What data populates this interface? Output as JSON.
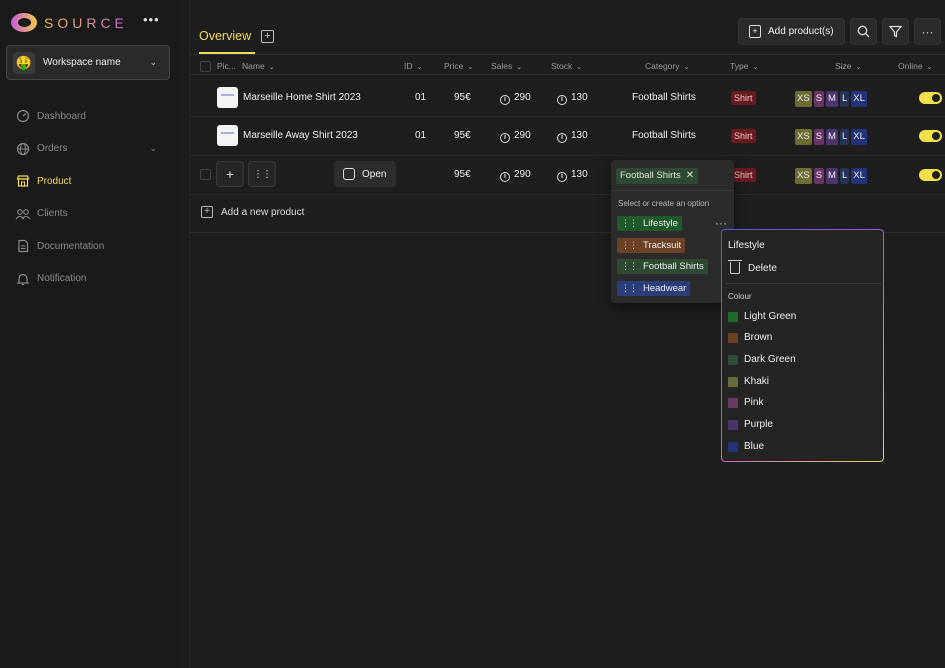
{
  "brand": {
    "name": "SOURCE"
  },
  "workspace": {
    "name": "Workspace name",
    "avatar": "🤑"
  },
  "nav": [
    {
      "label": "Dashboard",
      "icon": "gauge-icon",
      "active": false
    },
    {
      "label": "Orders",
      "icon": "globe-icon",
      "active": false,
      "expandable": true
    },
    {
      "label": "Product",
      "icon": "store-icon",
      "active": true
    },
    {
      "label": "Clients",
      "icon": "users-icon",
      "active": false
    },
    {
      "label": "Documentation",
      "icon": "document-icon",
      "active": false
    },
    {
      "label": "Notification",
      "icon": "bell-icon",
      "active": false
    }
  ],
  "header": {
    "tab_label": "Overview",
    "add_product_label": "Add product(s)"
  },
  "table": {
    "columns": {
      "picture": "Pic...",
      "name": "Name",
      "id": "ID",
      "price": "Price",
      "sales": "Sales",
      "stock": "Stock",
      "category": "Category",
      "type": "Type",
      "size": "Size",
      "online": "Online"
    },
    "rows": [
      {
        "name": "Marseille Home Shirt 2023",
        "id": "01",
        "price": "95€",
        "sales": "290",
        "stock": "130",
        "category": "Football Shirts",
        "type": "Shirt",
        "sizes": [
          "XS",
          "S",
          "M",
          "L",
          "XL"
        ],
        "online": true
      },
      {
        "name": "Marseille Away Shirt 2023",
        "id": "01",
        "price": "95€",
        "sales": "290",
        "stock": "130",
        "category": "Football Shirts",
        "type": "Shirt",
        "sizes": [
          "XS",
          "S",
          "M",
          "L",
          "XL"
        ],
        "online": true
      },
      {
        "name": "",
        "id": "",
        "price": "95€",
        "sales": "290",
        "stock": "130",
        "category": "Football Shirts",
        "type": "Shirt",
        "sizes": [
          "XS",
          "S",
          "M",
          "L",
          "XL"
        ],
        "online": true,
        "open_label": "Open"
      }
    ],
    "add_new_label": "Add a new product",
    "size_colors": {
      "XS": "#6e6b33",
      "S": "#6a3566",
      "M": "#4b3470",
      "L": "#253357",
      "XL": "#22337a"
    }
  },
  "category_dropdown": {
    "selected": "Football Shirts",
    "hint": "Select or create an option",
    "options": [
      {
        "label": "Lifestyle",
        "color": "#1f5a2a"
      },
      {
        "label": "Tracksuit",
        "color": "#6b4223"
      },
      {
        "label": "Football Shirts",
        "color": "#2f4a32"
      },
      {
        "label": "Headwear",
        "color": "#2a3f7a"
      }
    ]
  },
  "option_menu": {
    "title": "Lifestyle",
    "delete_label": "Delete",
    "colour_heading": "Colour",
    "colours": [
      {
        "label": "Light Green",
        "color": "#1f6b2a"
      },
      {
        "label": "Brown",
        "color": "#6b4223"
      },
      {
        "label": "Dark Green",
        "color": "#2f4a35"
      },
      {
        "label": "Khaki",
        "color": "#6b6a3a"
      },
      {
        "label": "Pink",
        "color": "#6a3a64"
      },
      {
        "label": "Purple",
        "color": "#4b346e"
      },
      {
        "label": "Blue",
        "color": "#22337a"
      }
    ]
  }
}
